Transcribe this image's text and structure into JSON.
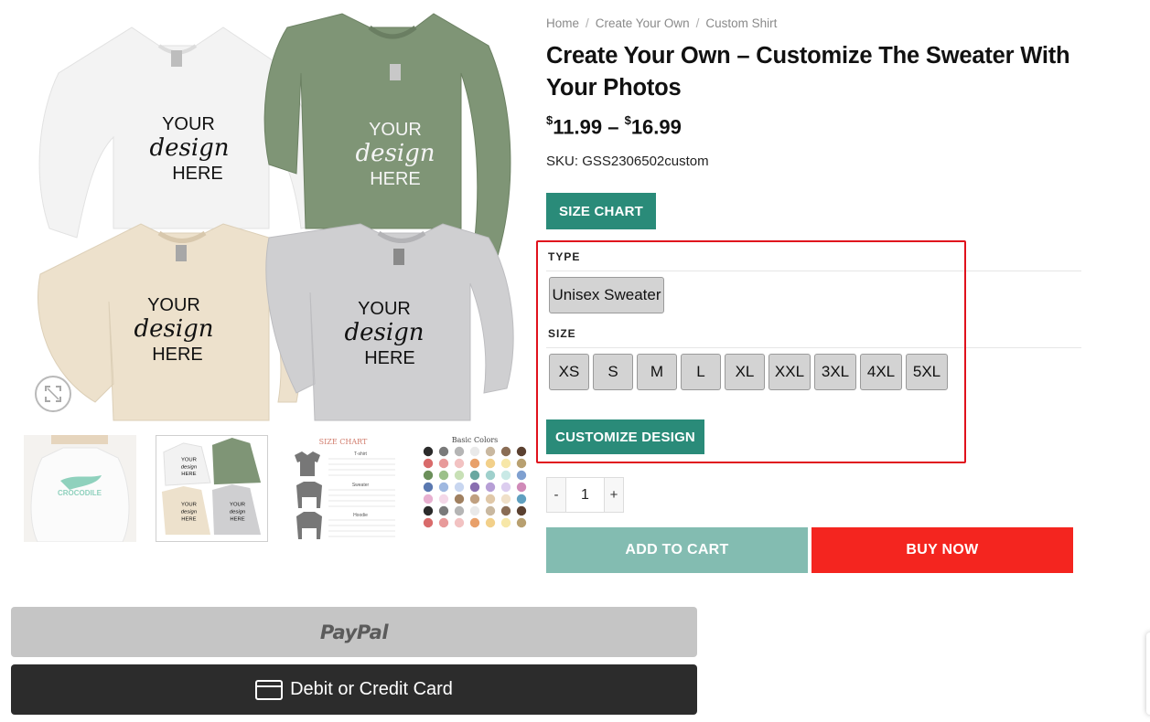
{
  "gallery": {
    "shirt_text": [
      "YOUR",
      "design",
      "HERE"
    ],
    "thumb_crocodile_text": "CROCODILE",
    "thumb_size_chart_title": "SIZE CHART",
    "thumb_size_chart_sections": [
      "T-shirt",
      "Sweater",
      "Hoodie"
    ],
    "thumb_colors_title": "Basic Colors",
    "zoom_icon": "expand-icon"
  },
  "breadcrumb": {
    "items": [
      "Home",
      "Create Your Own",
      "Custom Shirt"
    ],
    "separator": "/"
  },
  "product": {
    "title": "Create Your Own – Customize The Sweater With Your Photos",
    "price_currency": "$",
    "price_min": "11.99",
    "price_sep": "–",
    "price_max": "16.99",
    "sku_label": "SKU:",
    "sku_value": "GSS2306502custom"
  },
  "buttons": {
    "size_chart": "SIZE CHART",
    "customize": "CUSTOMIZE DESIGN",
    "add_to_cart": "ADD TO CART",
    "buy_now": "BUY NOW",
    "paypal": "PayPal",
    "card": "Debit or Credit Card"
  },
  "attributes": {
    "type_label": "TYPE",
    "type_options": [
      "Unisex Sweater"
    ],
    "size_label": "SIZE",
    "size_options": [
      "XS",
      "S",
      "M",
      "L",
      "XL",
      "XXL",
      "3XL",
      "4XL",
      "5XL"
    ]
  },
  "quantity": {
    "minus": "-",
    "value": "1",
    "plus": "+"
  },
  "colors": {
    "accent_green": "#2a8b79",
    "add_to_cart_bg": "#83bcb1",
    "buy_now_bg": "#f4251f",
    "highlight_border": "#e0111c",
    "paypal_bg": "#c5c5c5",
    "card_bg": "#2c2c2c",
    "swatch_bg": "#d3d3d3"
  }
}
